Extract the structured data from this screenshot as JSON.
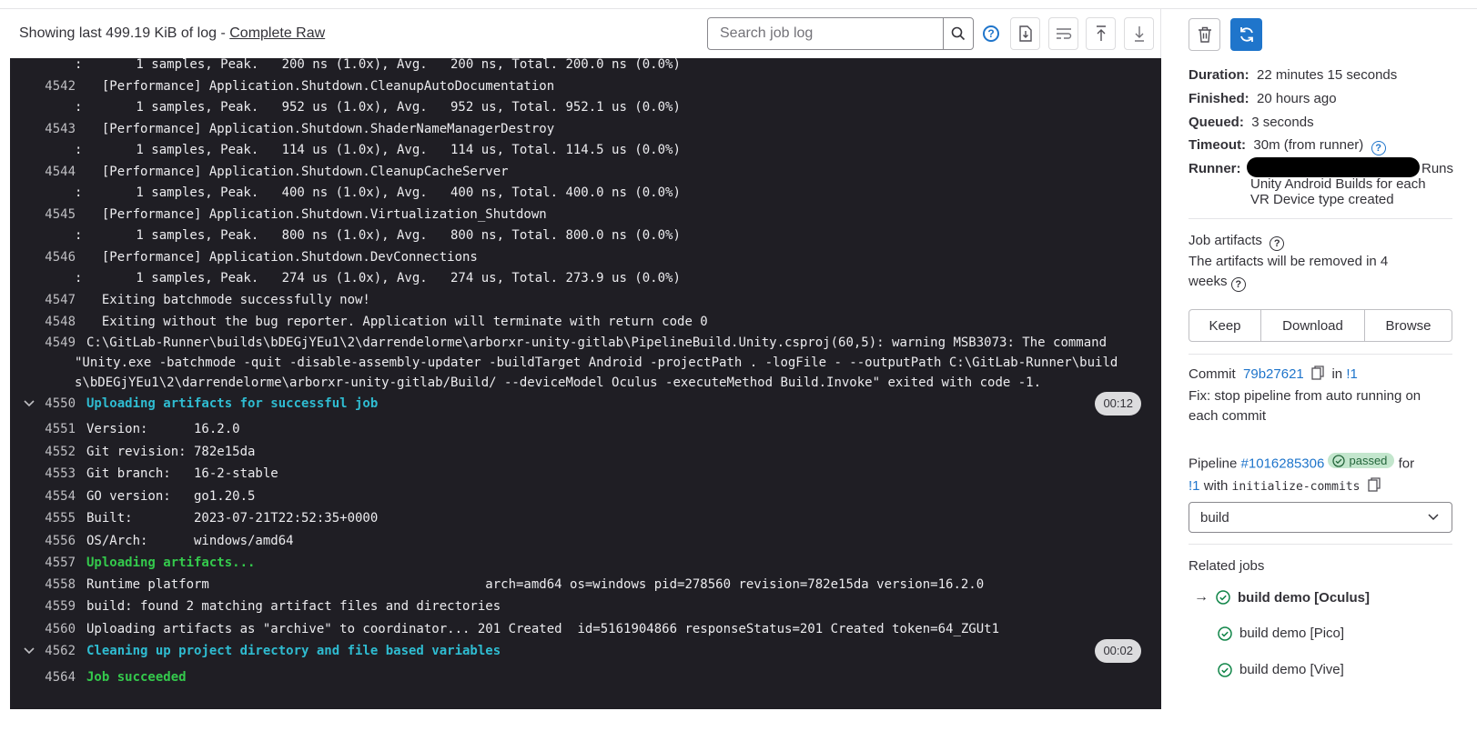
{
  "header": {
    "log_info": "Showing last 499.19 KiB of log - ",
    "raw_link": "Complete Raw",
    "search_placeholder": "Search job log"
  },
  "log": {
    "lines": [
      {
        "num": "",
        "text": ":       1 samples, Peak.   200 ns (1.0x), Avg.   200 ns, Total. 200.0 ns (0.0%)",
        "style": "cont"
      },
      {
        "num": "4542",
        "text": "  [Performance] Application.Shutdown.CleanupAutoDocumentation",
        "style": "normal"
      },
      {
        "num": "",
        "text": ":       1 samples, Peak.   952 us (1.0x), Avg.   952 us, Total. 952.1 us (0.0%)",
        "style": "cont"
      },
      {
        "num": "4543",
        "text": "  [Performance] Application.Shutdown.ShaderNameManagerDestroy",
        "style": "normal"
      },
      {
        "num": "",
        "text": ":       1 samples, Peak.   114 us (1.0x), Avg.   114 us, Total. 114.5 us (0.0%)",
        "style": "cont"
      },
      {
        "num": "4544",
        "text": "  [Performance] Application.Shutdown.CleanupCacheServer",
        "style": "normal"
      },
      {
        "num": "",
        "text": ":       1 samples, Peak.   400 ns (1.0x), Avg.   400 ns, Total. 400.0 ns (0.0%)",
        "style": "cont"
      },
      {
        "num": "4545",
        "text": "  [Performance] Application.Shutdown.Virtualization_Shutdown",
        "style": "normal"
      },
      {
        "num": "",
        "text": ":       1 samples, Peak.   800 ns (1.0x), Avg.   800 ns, Total. 800.0 ns (0.0%)",
        "style": "cont"
      },
      {
        "num": "4546",
        "text": "  [Performance] Application.Shutdown.DevConnections",
        "style": "normal"
      },
      {
        "num": "",
        "text": ":       1 samples, Peak.   274 us (1.0x), Avg.   274 us, Total. 273.9 us (0.0%)",
        "style": "cont"
      },
      {
        "num": "4547",
        "text": "  Exiting batchmode successfully now!",
        "style": "normal"
      },
      {
        "num": "4548",
        "text": "  Exiting without the bug reporter. Application will terminate with return code 0",
        "style": "normal"
      },
      {
        "num": "4549",
        "text": "C:\\GitLab-Runner\\builds\\bDEGjYEu1\\2\\darrendelorme\\arborxr-unity-gitlab\\PipelineBuild.Unity.csproj(60,5): warning MSB3073: The command",
        "style": "normal"
      },
      {
        "num": "",
        "text": "\"Unity.exe -batchmode -quit -disable-assembly-updater -buildTarget Android -projectPath . -logFile - --outputPath C:\\GitLab-Runner\\build",
        "style": "cont"
      },
      {
        "num": "",
        "text": "s\\bDEGjYEu1\\2\\darrendelorme\\arborxr-unity-gitlab/Build/ --deviceModel Oculus -executeMethod Build.Invoke\" exited with code -1.",
        "style": "cont"
      },
      {
        "num": "4550",
        "text": "Uploading artifacts for successful job",
        "style": "section",
        "duration": "00:12"
      },
      {
        "num": "4551",
        "text": "Version:      16.2.0",
        "style": "normal"
      },
      {
        "num": "4552",
        "text": "Git revision: 782e15da",
        "style": "normal"
      },
      {
        "num": "4553",
        "text": "Git branch:   16-2-stable",
        "style": "normal"
      },
      {
        "num": "4554",
        "text": "GO version:   go1.20.5",
        "style": "normal"
      },
      {
        "num": "4555",
        "text": "Built:        2023-07-21T22:52:35+0000",
        "style": "normal"
      },
      {
        "num": "4556",
        "text": "OS/Arch:      windows/amd64",
        "style": "normal"
      },
      {
        "num": "4557",
        "text": "Uploading artifacts...",
        "style": "green"
      },
      {
        "num": "4558",
        "text": "Runtime platform                                    arch=amd64 os=windows pid=278560 revision=782e15da version=16.2.0",
        "style": "normal"
      },
      {
        "num": "4559",
        "text": "build: found 2 matching artifact files and directories",
        "style": "normal"
      },
      {
        "num": "4560",
        "text": "Uploading artifacts as \"archive\" to coordinator... 201 Created  id=5161904866 responseStatus=201 Created token=64_ZGUt1",
        "style": "normal"
      },
      {
        "num": "4562",
        "text": "Cleaning up project directory and file based variables",
        "style": "section",
        "duration": "00:02"
      },
      {
        "num": "4564",
        "text": "Job succeeded",
        "style": "green"
      }
    ]
  },
  "sidebar": {
    "duration_label": "Duration:",
    "duration_value": "22 minutes 15 seconds",
    "finished_label": "Finished:",
    "finished_value": "20 hours ago",
    "queued_label": "Queued:",
    "queued_value": "3 seconds",
    "timeout_label": "Timeout:",
    "timeout_value": "30m (from runner)",
    "runner_label": "Runner:",
    "runner_desc_1": "Runs",
    "runner_desc_2": "Unity Android Builds for each",
    "runner_desc_3": "VR Device type created",
    "artifacts_title": "Job artifacts",
    "artifacts_note_1": "The artifacts will be removed in 4",
    "artifacts_note_2": "weeks",
    "keep": "Keep",
    "download": "Download",
    "browse": "Browse",
    "commit_label": "Commit",
    "commit_sha": "79b27621",
    "commit_in": "in",
    "commit_mr": "!1",
    "commit_msg_1": "Fix: stop pipeline from auto running on",
    "commit_msg_2": "each commit",
    "pipeline_label": "Pipeline",
    "pipeline_id": "#1016285306",
    "pipeline_status": "passed",
    "pipeline_for": "for",
    "pipeline_mr": "!1",
    "pipeline_with": "with",
    "pipeline_branch": "initialize-commits",
    "stage_select": "build",
    "related_title": "Related jobs",
    "related": [
      "build demo [Oculus]",
      "build demo [Pico]",
      "build demo [Vive]"
    ],
    "accent": "#1f75cb",
    "success": "#108548"
  }
}
